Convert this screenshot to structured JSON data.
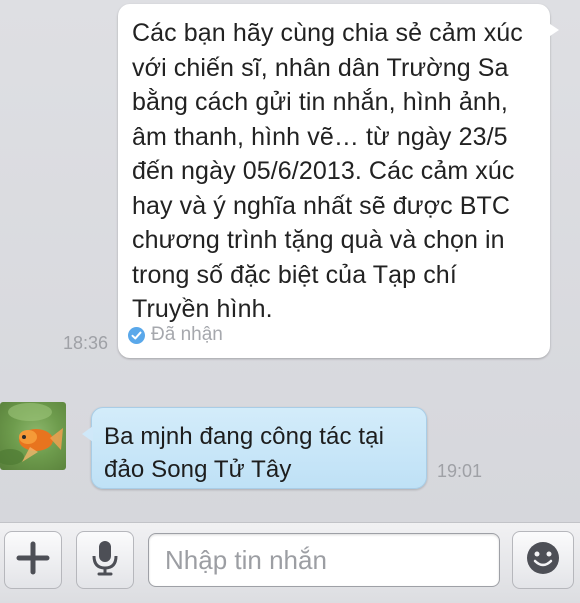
{
  "conversation": {
    "outgoing": {
      "text": "Các bạn hãy cùng chia sẻ cảm xúc với chiến sĩ, nhân dân Trường Sa bằng cách gửi tin nhắn, hình ảnh, âm thanh, hình vẽ… từ ngày 23/5 đến ngày 05/6/2013. Các cảm xúc hay và ý nghĩa nhất sẽ được BTC chương trình tặng quà và chọn in trong số đặc biệt của Tạp chí Truyền hình.",
      "status": "Đã nhận",
      "time": "18:36"
    },
    "incoming": {
      "text": "Ba mjnh đang công tác tại đảo Song Tử Tây",
      "time": "19:01"
    }
  },
  "composer": {
    "placeholder": "Nhập tin nhắn",
    "value": ""
  },
  "icons": {
    "attach": "plus-icon",
    "voice": "microphone-icon",
    "emoji": "smiley-icon",
    "status": "check-circle-icon"
  },
  "colors": {
    "incoming_bubble": "#c7e5f8",
    "outgoing_bubble": "#ffffff",
    "status_check": "#5aa8ea",
    "chat_background": "#dcdde1"
  }
}
